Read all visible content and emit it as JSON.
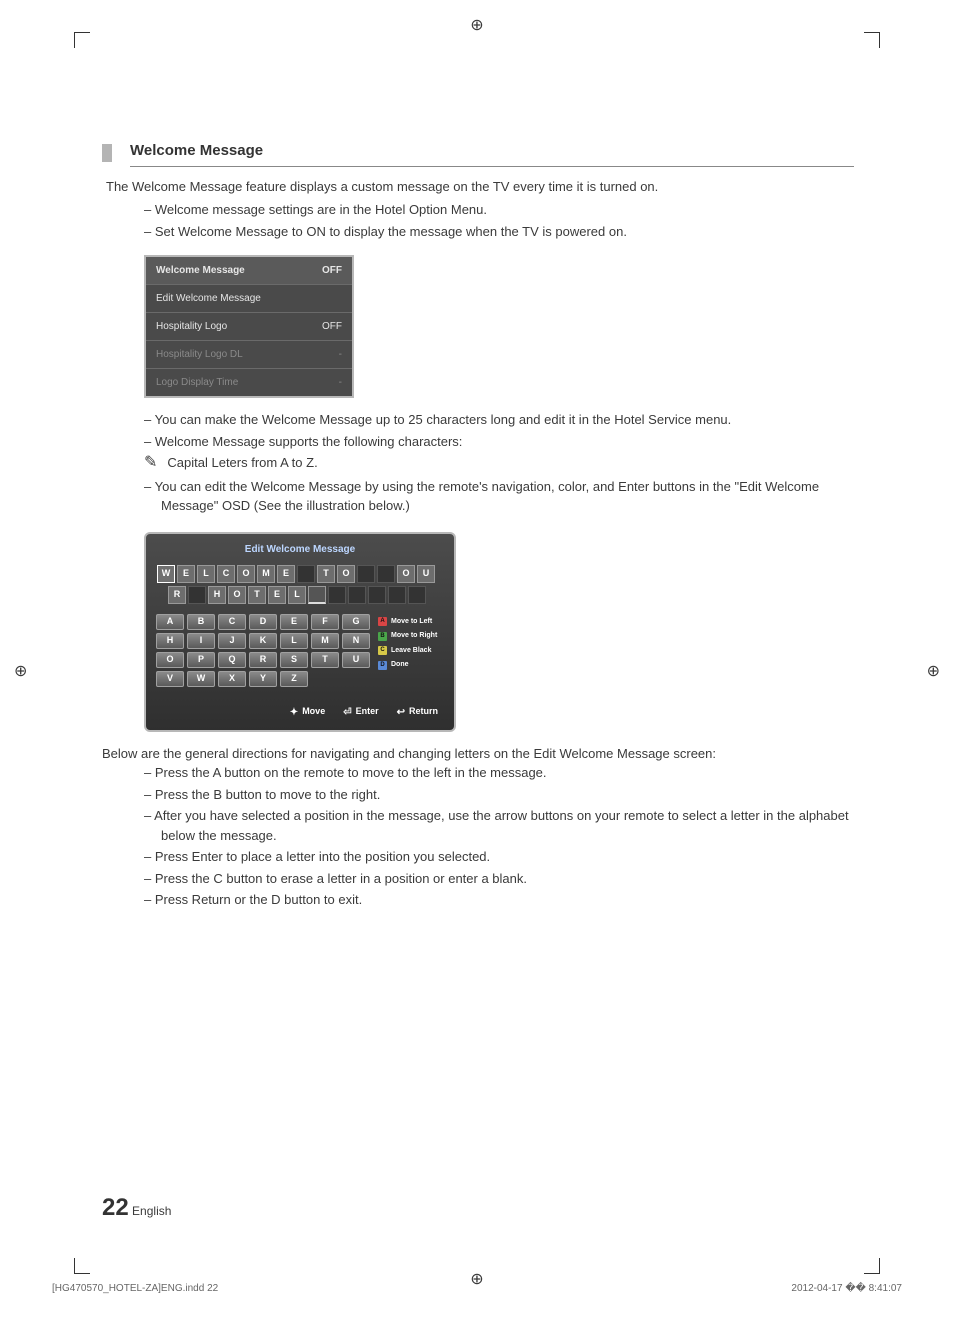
{
  "heading": "Welcome Message",
  "intro": "The Welcome Message feature displays a custom message on the TV every time it is turned on.",
  "bullets1": [
    "Welcome message settings are in the Hotel Option Menu.",
    "Set Welcome Message to ON to display the message when the TV is powered on."
  ],
  "settings": [
    {
      "label": "Welcome Message",
      "value": "OFF",
      "dim": false
    },
    {
      "label": "Edit Welcome Message",
      "value": "",
      "dim": false
    },
    {
      "label": "Hospitality Logo",
      "value": "OFF",
      "dim": false
    },
    {
      "label": "Hospitality Logo DL",
      "value": "-",
      "dim": true
    },
    {
      "label": "Logo Display Time",
      "value": "-",
      "dim": true
    }
  ],
  "bullets2": [
    "You can make the Welcome Message up to 25 characters long and edit it in the Hotel Service menu.",
    "Welcome Message supports the following characters:"
  ],
  "note": "Capital Leters from A to Z.",
  "bullets3": [
    "You can edit the Welcome Message by using the remote's navigation, color, and Enter buttons in the \"Edit Welcome Message\" OSD (See the illustration below.)"
  ],
  "editPanel": {
    "title": "Edit Welcome Message",
    "row1": [
      "W",
      "E",
      "L",
      "C",
      "O",
      "M",
      "E",
      "",
      "T",
      "O",
      "",
      "",
      "O",
      "U"
    ],
    "row2": [
      "R",
      "",
      "H",
      "O",
      "T",
      "E",
      "L",
      "_",
      "",
      "",
      "",
      "",
      ""
    ],
    "letters": [
      "A",
      "B",
      "C",
      "D",
      "E",
      "F",
      "G",
      "H",
      "I",
      "J",
      "K",
      "L",
      "M",
      "N",
      "O",
      "P",
      "Q",
      "R",
      "S",
      "T",
      "U",
      "V",
      "W",
      "X",
      "Y",
      "Z",
      "",
      ""
    ],
    "legend": [
      {
        "key": "A",
        "cls": "sq-a",
        "label": "Move to Left"
      },
      {
        "key": "B",
        "cls": "sq-b",
        "label": "Move to Right"
      },
      {
        "key": "C",
        "cls": "sq-c",
        "label": "Leave Black"
      },
      {
        "key": "D",
        "cls": "sq-d",
        "label": "Done"
      }
    ],
    "nav": [
      {
        "icon": "✦",
        "label": "Move"
      },
      {
        "icon": "⏎",
        "label": "Enter"
      },
      {
        "icon": "↩",
        "label": "Return"
      }
    ]
  },
  "directionsIntro": "Below are the general directions for navigating and changing letters on the Edit Welcome Message screen:",
  "directions": [
    "Press the A button on the remote to move to the left in the message.",
    "Press the B button to move to the right.",
    "After you have selected a position in the message, use the arrow buttons on your remote to select a letter in the alphabet below the message.",
    "Press Enter to place a letter into the position you selected.",
    "Press the C button to erase a letter in a position or enter a blank.",
    "Press Return or the D button to exit."
  ],
  "pageNumber": "22",
  "pageLang": "English",
  "printFile": "[HG470570_HOTEL-ZA]ENG.indd   22",
  "printDate": "2012-04-17   �� 8:41:07"
}
